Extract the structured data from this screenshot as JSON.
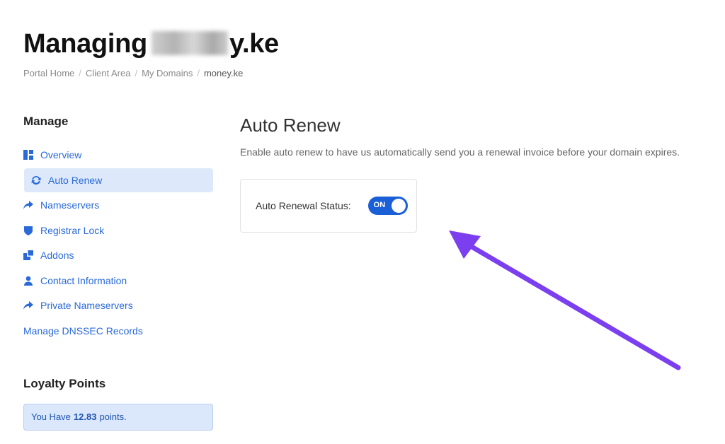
{
  "header": {
    "title_prefix": "Managing",
    "title_suffix": "y.ke"
  },
  "breadcrumb": [
    "Portal Home",
    "Client Area",
    "My Domains",
    "money.ke"
  ],
  "sidebar": {
    "heading": "Manage",
    "items": [
      {
        "label": "Overview",
        "icon": "overview-icon"
      },
      {
        "label": "Auto Renew",
        "icon": "refresh-icon",
        "active": true
      },
      {
        "label": "Nameservers",
        "icon": "share-arrow-icon"
      },
      {
        "label": "Registrar Lock",
        "icon": "shield-icon"
      },
      {
        "label": "Addons",
        "icon": "addons-icon"
      },
      {
        "label": "Contact Information",
        "icon": "user-icon"
      },
      {
        "label": "Private Nameservers",
        "icon": "share-arrow-icon"
      },
      {
        "label": "Manage DNSSEC Records",
        "icon": ""
      }
    ],
    "loyalty_heading": "Loyalty Points",
    "loyalty_prefix": "You Have",
    "loyalty_points": "12.83",
    "loyalty_suffix": "points."
  },
  "main": {
    "title": "Auto Renew",
    "description": "Enable auto renew to have us automatically send you a renewal invoice before your domain expires.",
    "status_label": "Auto Renewal Status:",
    "toggle_text": "ON"
  },
  "colors": {
    "link": "#2a6ad8",
    "toggle_on": "#1a5fd6",
    "arrow": "#7b3fef"
  }
}
